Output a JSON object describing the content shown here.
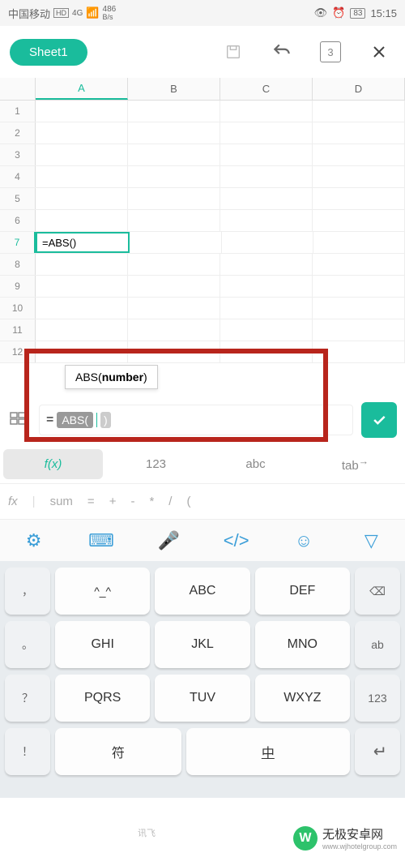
{
  "status": {
    "carrier": "中国移动",
    "net_badge": "HD",
    "net_type": "4G",
    "speed": "486",
    "speed_unit": "B/s",
    "battery": "83",
    "time": "15:15"
  },
  "toolbar": {
    "sheet_name": "Sheet1",
    "page_number": "3"
  },
  "grid": {
    "columns": [
      "A",
      "B",
      "C",
      "D"
    ],
    "rows": [
      "1",
      "2",
      "3",
      "4",
      "5",
      "6",
      "7",
      "8",
      "9",
      "10",
      "11",
      "12"
    ],
    "active_col": "A",
    "active_row": "7",
    "active_cell_value": "=ABS()"
  },
  "tooltip": {
    "prefix": "ABS(",
    "arg": "number",
    "suffix": ")"
  },
  "formula": {
    "equals": "=",
    "chip": "ABS(",
    "close": ")"
  },
  "mode_tabs": {
    "fx": "f(x)",
    "num": "123",
    "abc": "abc",
    "tab": "tab"
  },
  "fx_bar": {
    "label": "fx",
    "sum": "sum",
    "eq": "=",
    "plus": "+",
    "minus": "-",
    "mult": "*",
    "div": "/",
    "paren": "("
  },
  "keyboard": {
    "row1": {
      "side_l": "，",
      "k1": "^_^",
      "k2": "ABC",
      "k3": "DEF",
      "side_r": "⌫"
    },
    "row2": {
      "side_l": "。",
      "k1": "GHI",
      "k2": "JKL",
      "k3": "MNO",
      "side_r": "ab"
    },
    "row3": {
      "side_l": "？",
      "k1": "PQRS",
      "k2": "TUV",
      "k3": "WXYZ",
      "side_r": "123"
    },
    "row4": {
      "side_l": "！",
      "k1": "符",
      "k2": "中",
      "side_r": ""
    }
  },
  "watermark": {
    "logo": "W",
    "title": "无极安卓网",
    "sub": "www.wjhotelgroup.com"
  },
  "ime_brand": "讯飞"
}
